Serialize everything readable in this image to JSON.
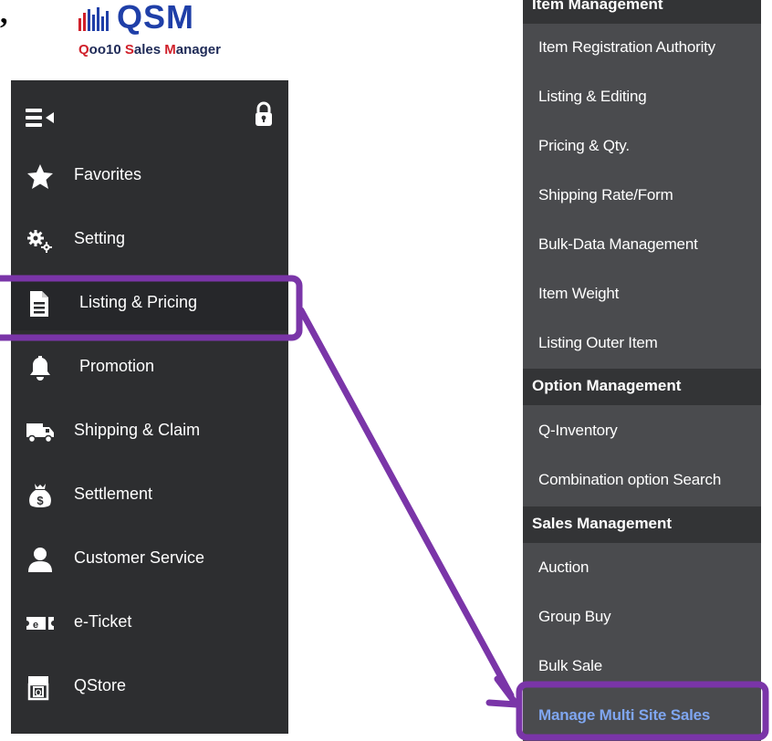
{
  "stray_mark": ",",
  "logo": {
    "wordmark": "QSM",
    "subtitle_parts": [
      {
        "text": "Q",
        "accent": true
      },
      {
        "text": "oo10 ",
        "accent": false
      },
      {
        "text": "S",
        "accent": true
      },
      {
        "text": "ales ",
        "accent": false
      },
      {
        "text": "M",
        "accent": true
      },
      {
        "text": "anager",
        "accent": false
      }
    ],
    "colors": {
      "primary": "#1f3fa8",
      "accent": "#d0202a",
      "bar_colors": [
        "#d0202a",
        "#1f3fa8"
      ]
    }
  },
  "sidebar": {
    "toggle_icon": "hamburger-collapse-icon",
    "lock_icon": "lock-icon",
    "items": [
      {
        "label": "Favorites",
        "icon": "star-icon"
      },
      {
        "label": "Setting",
        "icon": "gears-icon"
      },
      {
        "label": "Listing & Pricing",
        "icon": "document-icon",
        "active": true
      },
      {
        "label": "Promotion",
        "icon": "bell-icon"
      },
      {
        "label": "Shipping & Claim",
        "icon": "truck-icon"
      },
      {
        "label": "Settlement",
        "icon": "money-bag-icon"
      },
      {
        "label": "Customer Service",
        "icon": "person-icon"
      },
      {
        "label": "e-Ticket",
        "icon": "ticket-icon"
      },
      {
        "label": "QStore",
        "icon": "store-icon"
      }
    ]
  },
  "submenu": {
    "sections": [
      {
        "header": "Item Management",
        "items": [
          "Item Registration Authority",
          "Listing & Editing",
          "Pricing & Qty.",
          "Shipping Rate/Form",
          "Bulk-Data Management",
          "Item Weight",
          "Listing Outer Item"
        ]
      },
      {
        "header": "Option Management",
        "items": [
          "Q-Inventory",
          "Combination option Search"
        ]
      },
      {
        "header": "Sales Management",
        "items": [
          "Auction",
          "Group Buy",
          "Bulk Sale",
          "Manage Multi Site Sales"
        ]
      }
    ],
    "highlighted_item": "Manage Multi Site Sales",
    "highlight_color": "#7fa6f0"
  },
  "annotation": {
    "color": "#7a35a8",
    "type": "callout-box-with-arrow"
  }
}
